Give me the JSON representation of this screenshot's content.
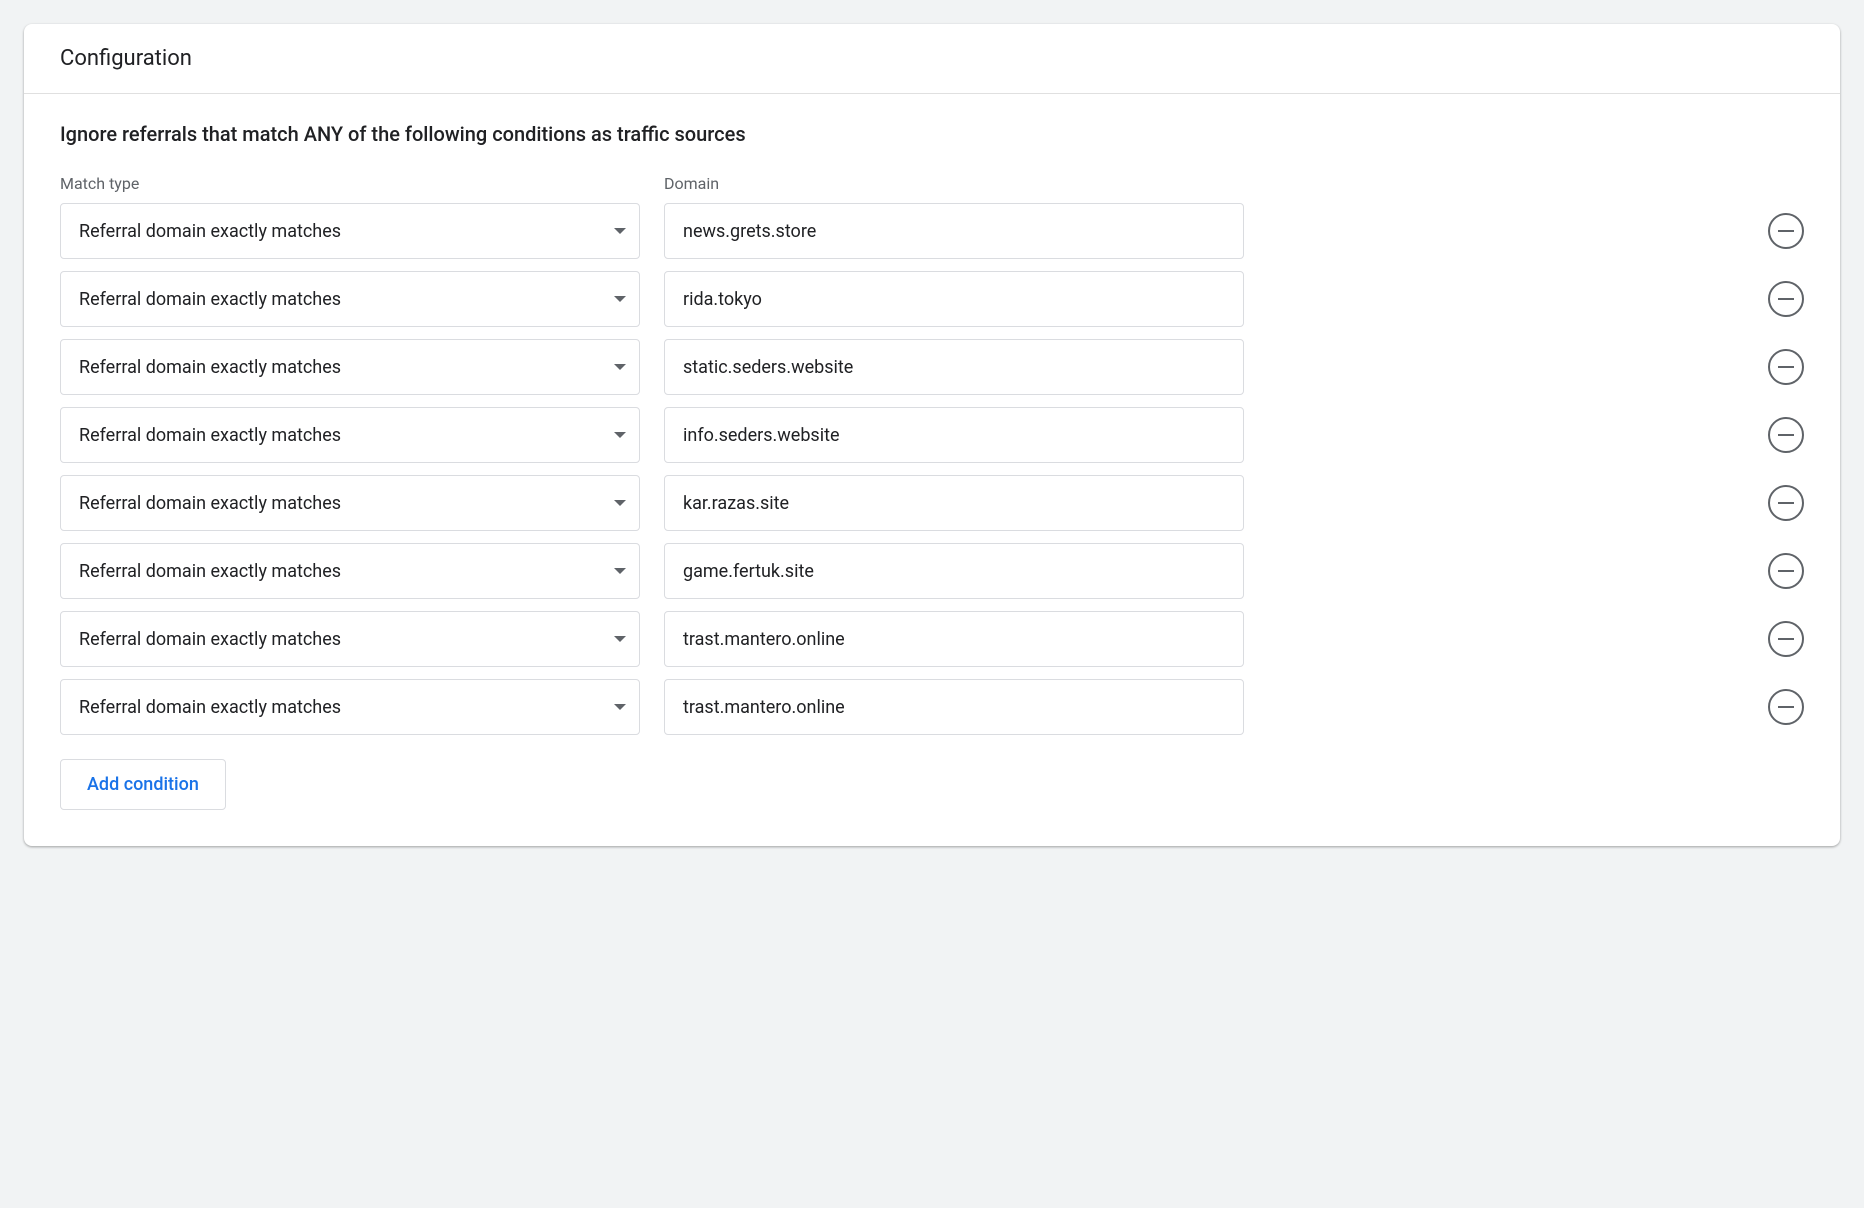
{
  "header": {
    "title": "Configuration"
  },
  "instruction": "Ignore referrals that match ANY of the following conditions as traffic sources",
  "columns": {
    "matchType": "Match type",
    "domain": "Domain"
  },
  "conditions": [
    {
      "matchType": "Referral domain exactly matches",
      "domain": "news.grets.store"
    },
    {
      "matchType": "Referral domain exactly matches",
      "domain": "rida.tokyo"
    },
    {
      "matchType": "Referral domain exactly matches",
      "domain": "static.seders.website"
    },
    {
      "matchType": "Referral domain exactly matches",
      "domain": "info.seders.website"
    },
    {
      "matchType": "Referral domain exactly matches",
      "domain": "kar.razas.site"
    },
    {
      "matchType": "Referral domain exactly matches",
      "domain": "game.fertuk.site"
    },
    {
      "matchType": "Referral domain exactly matches",
      "domain": "trast.mantero.online"
    },
    {
      "matchType": "Referral domain exactly matches",
      "domain": "trast.mantero.online"
    }
  ],
  "buttons": {
    "addCondition": "Add condition"
  }
}
